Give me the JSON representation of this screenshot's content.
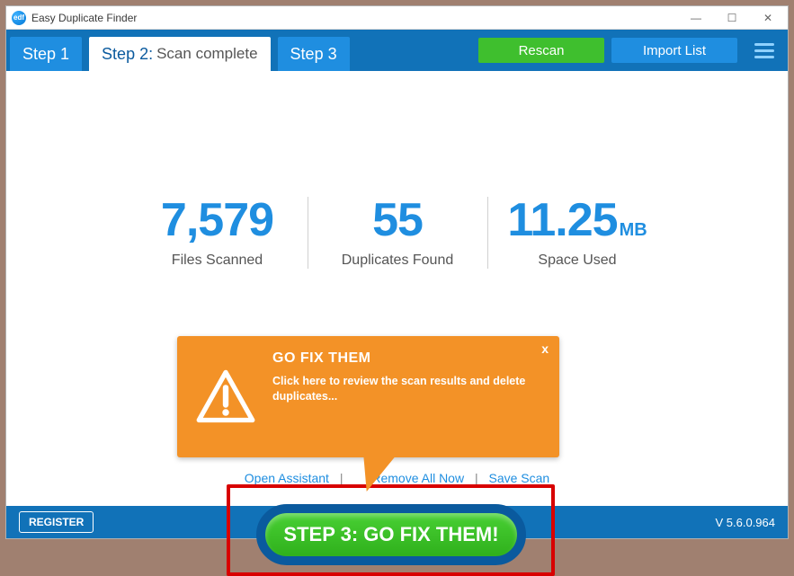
{
  "window": {
    "title": "Easy Duplicate Finder"
  },
  "tabs": {
    "step1": "Step 1",
    "step2_prefix": "Step 2:",
    "step2_status": "Scan complete",
    "step3": "Step 3"
  },
  "actions": {
    "rescan": "Rescan",
    "import": "Import  List"
  },
  "stats": {
    "scanned": {
      "value": "7,579",
      "label": "Files Scanned"
    },
    "dupes": {
      "value": "55",
      "label": "Duplicates Found"
    },
    "space": {
      "value": "11.25",
      "unit": "MB",
      "label": "Space Used"
    }
  },
  "links": {
    "assistant": "Open Assistant",
    "removeall": "Remove All Now",
    "savescan": "Save Scan"
  },
  "bigbutton": "STEP 3: GO FIX THEM!",
  "tooltip": {
    "title": "GO FIX THEM",
    "body": "Click here to review the scan results and delete duplicates...",
    "close": "x"
  },
  "footer": {
    "register": "REGISTER",
    "version": "V 5.6.0.964"
  }
}
